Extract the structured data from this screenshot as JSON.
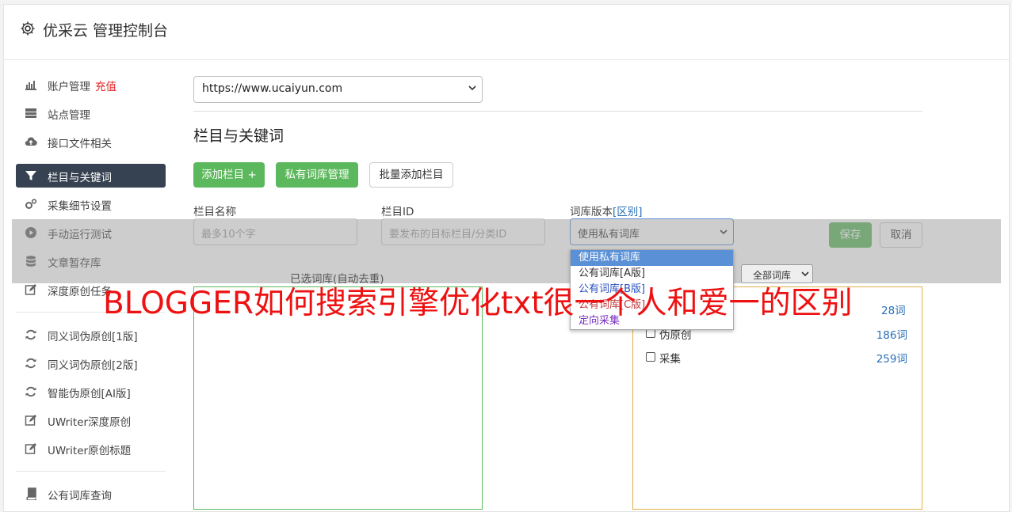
{
  "header": {
    "title": "优采云 管理控制台",
    "icon": "gear-icon"
  },
  "sidebar": {
    "items": [
      {
        "label": "账户管理",
        "extra": "充值",
        "icon": "bar-chart-icon"
      },
      {
        "label": "站点管理",
        "icon": "server-icon"
      },
      {
        "label": "接口文件相关",
        "icon": "cloud-upload-icon"
      },
      {
        "label": "栏目与关键词",
        "icon": "filter-icon",
        "active": true
      },
      {
        "label": "采集细节设置",
        "icon": "gears-icon"
      },
      {
        "label": "手动运行测试",
        "icon": "play-circle-icon"
      },
      {
        "label": "文章暂存库",
        "icon": "database-icon"
      },
      {
        "label": "深度原创任务",
        "icon": "edit-icon"
      },
      {
        "label": "同义词伪原创[1版]",
        "icon": "refresh-icon"
      },
      {
        "label": "同义词伪原创[2版]",
        "icon": "refresh-icon"
      },
      {
        "label": "智能伪原创[AI版]",
        "icon": "refresh-icon"
      },
      {
        "label": "UWriter深度原创",
        "icon": "edit-icon"
      },
      {
        "label": "UWriter原创标题",
        "icon": "edit-icon"
      },
      {
        "label": "公有词库查询",
        "icon": "book-icon"
      }
    ]
  },
  "main": {
    "site_select": {
      "value": "https://www.ucaiyun.com"
    },
    "section_title": "栏目与关键词",
    "buttons": {
      "add": "添加栏目 +",
      "private": "私有词库管理",
      "batch": "批量添加栏目",
      "save": "保存",
      "cancel": "取消"
    },
    "form": {
      "name_label": "栏目名称",
      "name_placeholder": "最多10个字",
      "id_label": "栏目ID",
      "id_placeholder": "要发布的目标栏目/分类ID",
      "version_label": "词库版本",
      "version_link": "[区别]",
      "version_value": "使用私有词库"
    },
    "dropdown_options": [
      "使用私有词库",
      "公有词库[A版]",
      "公有词库[B版]",
      "公有词库[C版]",
      "定向采集"
    ],
    "picker": {
      "selected_label": "已选词库(自动去重)",
      "filter_value": "全部词库",
      "items": [
        {
          "label": "伪原创",
          "count": "186词"
        },
        {
          "label": "采集",
          "count": "259词"
        }
      ],
      "partial_count": "28词"
    }
  },
  "watermark": "BLOGGER如何搜索引擎优化txt很一个人和爱一的区别",
  "colors": {
    "accent_green": "#5cb85c",
    "active_nav": "#364151",
    "link": "#2a6fb7",
    "watermark": "#ee1111"
  }
}
